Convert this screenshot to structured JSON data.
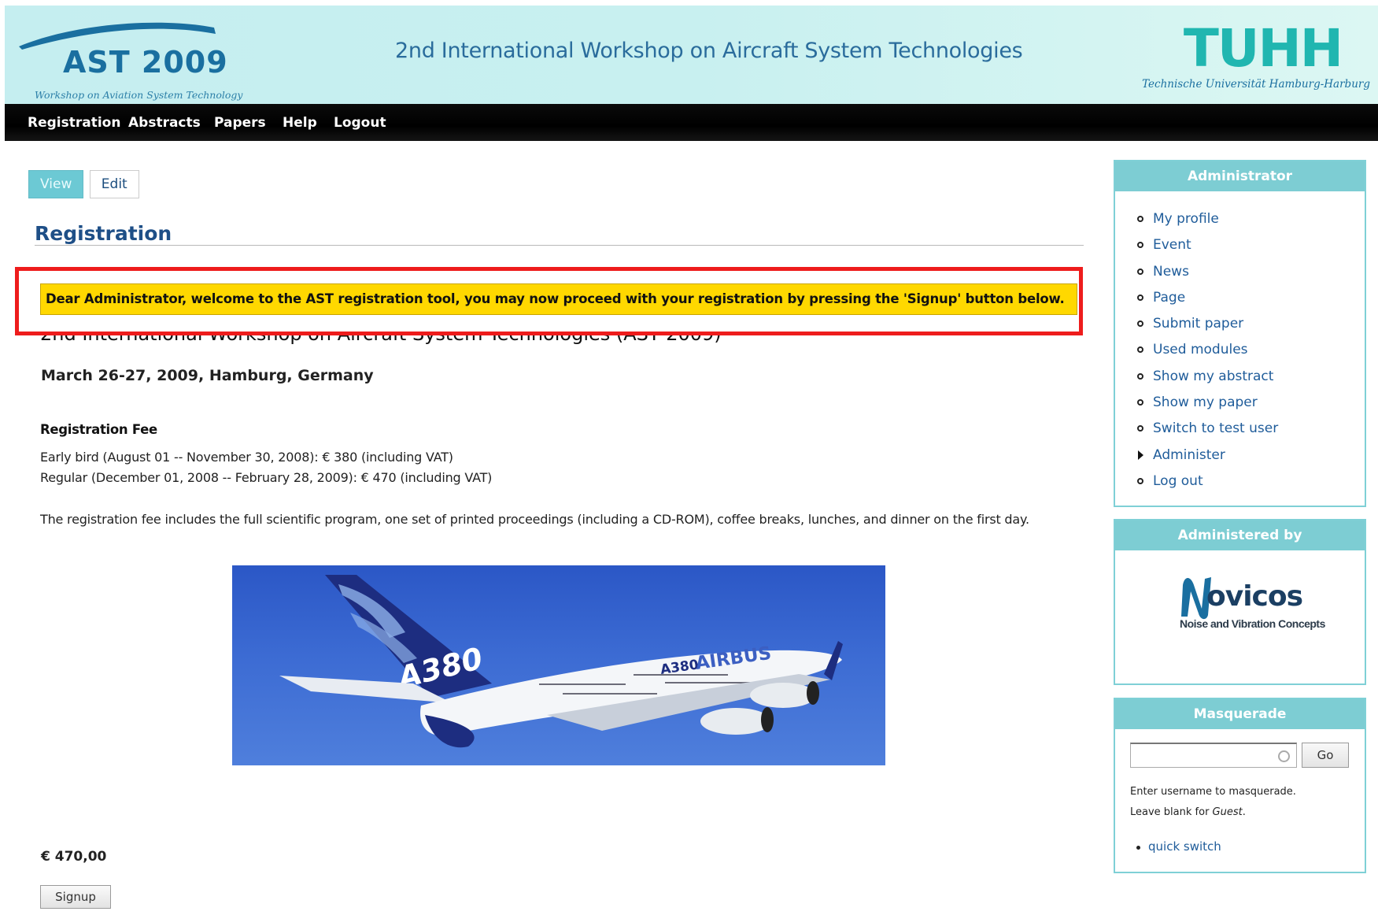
{
  "header": {
    "ast_logo_title": "AST 2009",
    "ast_logo_subtitle": "Workshop on Aviation System Technology",
    "site_title": "2nd International Workshop on Aircraft System Technologies",
    "tuhh_logo_mark": "TUHH",
    "tuhh_logo_name": "Technische Universität Hamburg-Harburg"
  },
  "nav": {
    "items": [
      "Registration",
      "Abstracts",
      "Papers",
      "Help",
      "Logout"
    ]
  },
  "tabs": {
    "view": "View",
    "edit": "Edit",
    "active": "View"
  },
  "main": {
    "page_title": "Registration",
    "status_message": "Dear Administrator, welcome to the AST registration tool, you may now proceed with your registration by pressing the 'Signup' button below.",
    "event_title": "2nd International Workshop on Aircraft System Technologies (AST 2009)",
    "event_date": "March 26-27, 2009, Hamburg, Germany",
    "fee_heading": "Registration Fee",
    "fee_early": "Early bird (August 01 -- November 30, 2008): € 380 (including VAT)",
    "fee_regular": "Regular (December 01, 2008 -- February 28, 2009): € 470 (including VAT)",
    "fee_description": "The registration fee includes the full scientific program, one set of printed proceedings (including a CD-ROM), coffee breaks, lunches, and dinner on the first day.",
    "image_text": {
      "tail": "A380",
      "fuselage_model": "A380",
      "fuselage_brand": "AIRBUS"
    },
    "price": "€ 470,00",
    "signup_label": "Signup"
  },
  "sidebar": {
    "admin_block": {
      "title": "Administrator",
      "items": [
        {
          "label": "My profile",
          "marker": "circle"
        },
        {
          "label": "Event",
          "marker": "circle"
        },
        {
          "label": "News",
          "marker": "circle"
        },
        {
          "label": "Page",
          "marker": "circle"
        },
        {
          "label": "Submit paper",
          "marker": "circle"
        },
        {
          "label": "Used modules",
          "marker": "circle"
        },
        {
          "label": "Show my abstract",
          "marker": "circle"
        },
        {
          "label": "Show my paper",
          "marker": "circle"
        },
        {
          "label": "Switch to test user",
          "marker": "circle"
        },
        {
          "label": "Administer",
          "marker": "triangle"
        },
        {
          "label": "Log out",
          "marker": "circle"
        }
      ]
    },
    "administered_block": {
      "title": "Administered by",
      "logo_word": "ovicos",
      "logo_tagline": "Noise and Vibration Concepts"
    },
    "masquerade_block": {
      "title": "Masquerade",
      "input_value": "",
      "go_label": "Go",
      "help_line1": "Enter username to masquerade.",
      "help_line2_prefix": "Leave blank for ",
      "help_line2_guest": "Guest",
      "help_line2_suffix": ".",
      "links": [
        "quick switch"
      ]
    }
  },
  "colors": {
    "header_bg": "#c8f0f0",
    "nav_bg": "#000000",
    "accent_teal": "#7dcdd3",
    "title_blue": "#1e4f87",
    "link_blue": "#1f5c9a",
    "status_yellow": "#ffd800",
    "highlight_red": "#ee1c1c"
  }
}
